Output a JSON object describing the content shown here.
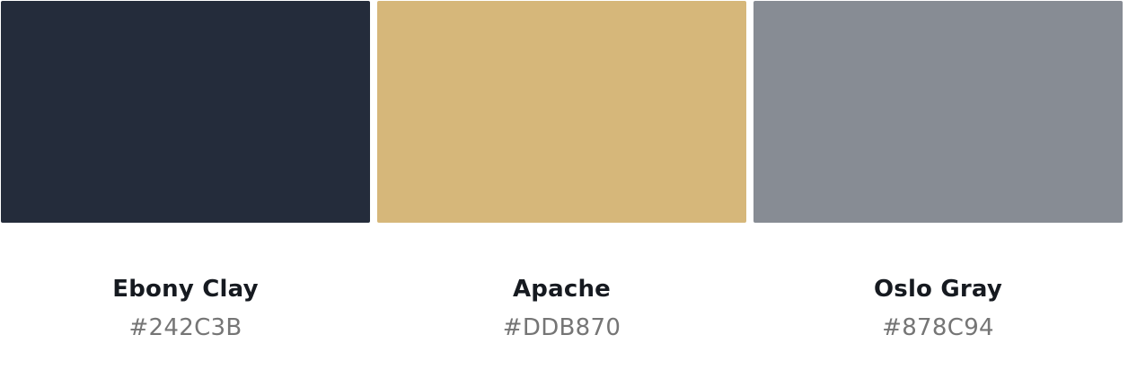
{
  "palette": {
    "colors": [
      {
        "name": "Ebony Clay",
        "hex": "#242C3B"
      },
      {
        "name": "Apache",
        "hex": "#DDB870"
      },
      {
        "name": "Oslo Gray",
        "hex": "#878C94"
      }
    ]
  }
}
